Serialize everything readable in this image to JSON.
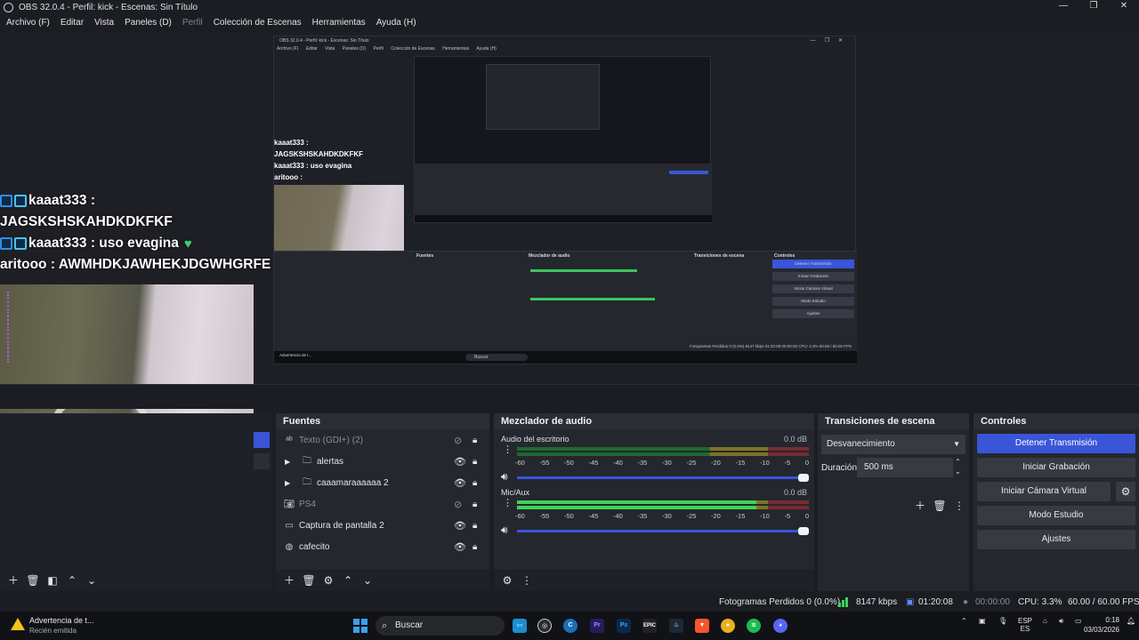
{
  "window": {
    "title": "OBS 32.0.4 - Perfil: kick - Escenas: Sin Título",
    "controls": [
      "—",
      "❐",
      "✕"
    ]
  },
  "menu": {
    "items": [
      "Archivo (F)",
      "Editar",
      "Vista",
      "Paneles (D)",
      "Perfil",
      "Colección de Escenas",
      "Herramientas",
      "Ayuda (H)"
    ],
    "disabled": [
      "Perfil"
    ]
  },
  "preview": {
    "chat": [
      {
        "user": "kaaat333",
        "text": ":"
      },
      {
        "user": "",
        "text": "JAGSKSHSKAHDKDKFKF"
      },
      {
        "user": "kaaat333",
        "text": ": uso evagina"
      },
      {
        "user": "aritooo",
        "text": ": AWMHDKJAWHEKJDGWHGRFE"
      }
    ],
    "nested": {
      "title": "OBS 32.0.4 - Perfil: kick - Escenas: Sin Título",
      "menu": [
        "Archivo (F)",
        "Editar",
        "Vista",
        "Paneles (D)",
        "Perfil",
        "Colección de Escenas",
        "Herramientas",
        "Ayuda (H)"
      ],
      "chat": [
        "kaaat333 :",
        "JAGSKSHSKAHDKDKFKF",
        "kaaat333 : uso evagina",
        "aritooo : AWMHDKJAWHEKJDGWHGRFE"
      ],
      "headers": [
        "Fuentes",
        "Mezclador de audio",
        "Transiciones de escena",
        "Controles"
      ],
      "buttons": [
        "Detener Transmisión",
        "Iniciar Grabación",
        "Iniciar Cámara Virtual",
        "Modo Estudio",
        "Ajustes"
      ],
      "search": "Buscar",
      "warning": "Advertencia de t...",
      "status": "Fotogramas Perdidos 0 (0.0%)   8147 kbps   01:20:08   00:00:00   CPU: 3.3%   60.00 / 60.00 FPS"
    }
  },
  "sources": {
    "header": "Fuentes",
    "items": [
      {
        "label": "Texto (GDI+) (2)",
        "icon": "text-icon",
        "hidden": true,
        "group": false
      },
      {
        "label": "alertas",
        "icon": "folder-icon",
        "hidden": false,
        "group": true
      },
      {
        "label": "caaamaraaaaaa 2",
        "icon": "folder-icon",
        "hidden": false,
        "group": true
      },
      {
        "label": "PS4",
        "icon": "camera-icon",
        "hidden": true,
        "group": false
      },
      {
        "label": "Captura de pantalla 2",
        "icon": "monitor-icon",
        "hidden": false,
        "group": false
      },
      {
        "label": "cafecito",
        "icon": "globe-icon",
        "hidden": false,
        "group": false
      }
    ]
  },
  "mixer": {
    "header": "Mezclador de audio",
    "ticks": [
      "-60",
      "-55",
      "-50",
      "-45",
      "-40",
      "-35",
      "-30",
      "-25",
      "-20",
      "-15",
      "-10",
      "-5",
      "0"
    ],
    "channels": [
      {
        "name": "Audio del escritorio",
        "db": "0.0 dB",
        "level": 0,
        "volume": 1.0
      },
      {
        "name": "Mic/Aux",
        "db": "0.0 dB",
        "level": 0.82,
        "volume": 1.0
      }
    ]
  },
  "transitions": {
    "header": "Transiciones de escena",
    "selected": "Desvanecimiento",
    "duration_label": "Duración",
    "duration_value": "500 ms"
  },
  "controls": {
    "header": "Controles",
    "stop_stream": "Detener Transmisión",
    "start_recording": "Iniciar Grabación",
    "start_virtual_cam": "Iniciar Cámara Virtual",
    "studio_mode": "Modo Estudio",
    "settings": "Ajustes"
  },
  "status": {
    "dropped_frames": "Fotogramas Perdidos 0 (0.0%)",
    "bitrate": "8147 kbps",
    "stream_time": "01:20:08",
    "record_time": "00:00:00",
    "cpu": "CPU: 3.3%",
    "fps": "60.00 / 60.00 FPS"
  },
  "taskbar": {
    "notification_title": "Advertencia de t...",
    "notification_sub": "Recién emitida",
    "search": "Buscar",
    "language": "ESP",
    "language_sub": "ES",
    "time": "0:18",
    "date": "03/03/2026"
  },
  "colors": {
    "accent": "#3a55d8",
    "meter_green": "#3fd25b",
    "panel": "#24272e"
  }
}
